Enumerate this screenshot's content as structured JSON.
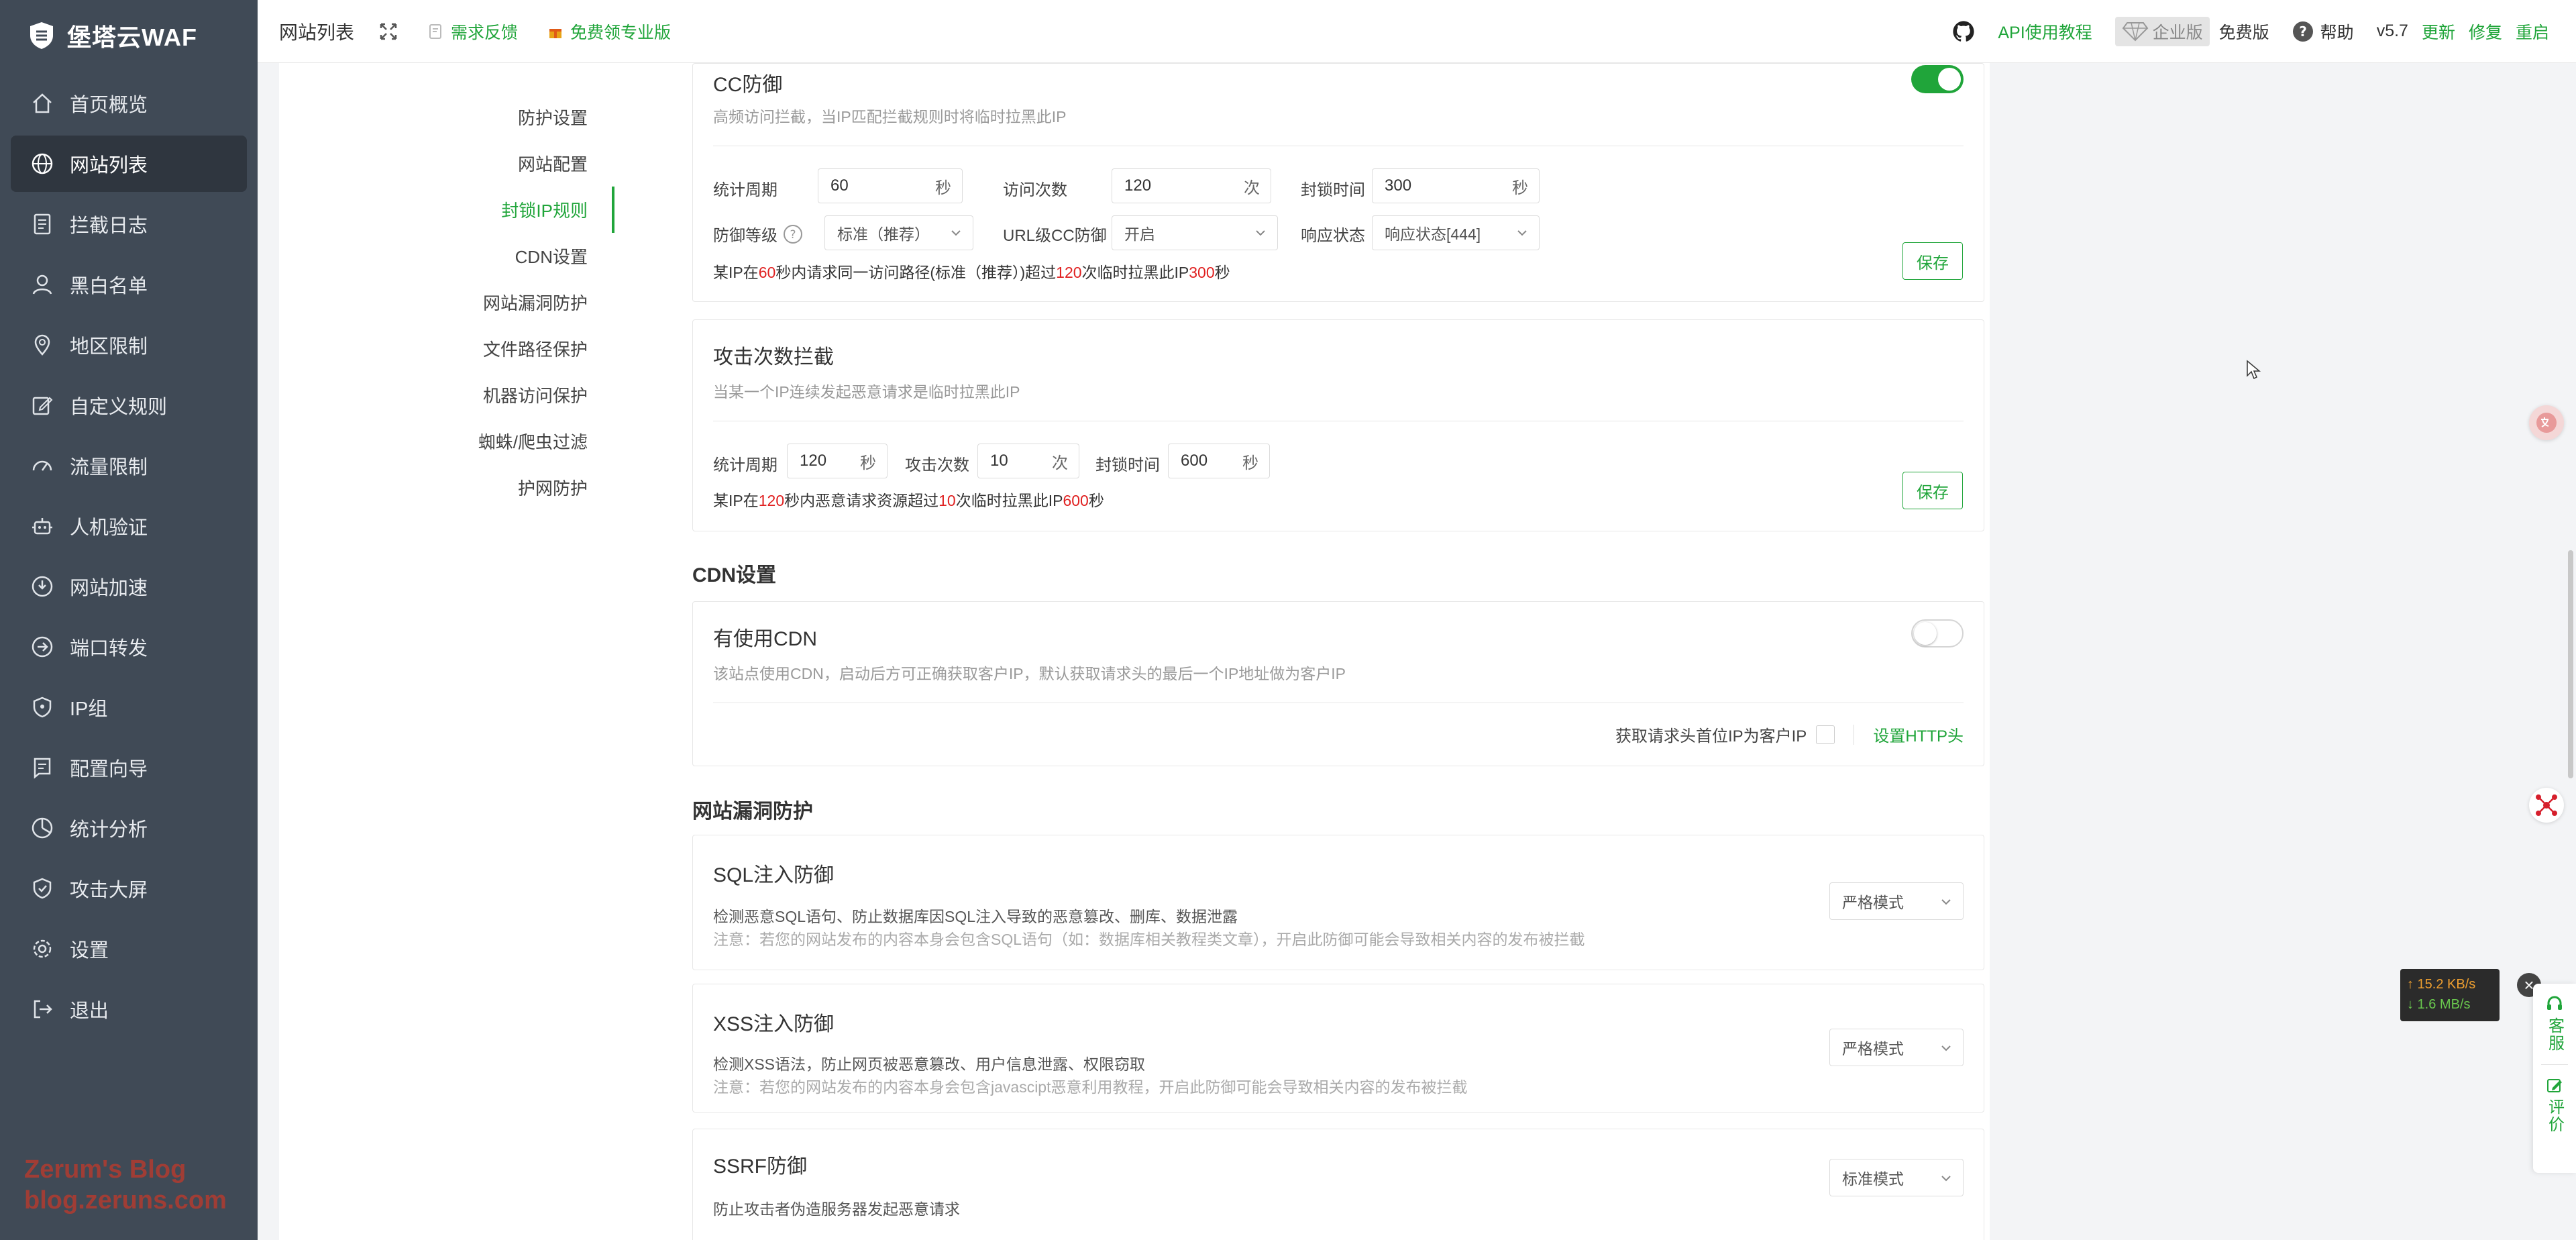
{
  "app": {
    "logo_text": "堡塔云WAF"
  },
  "sidebar": {
    "items": [
      {
        "label": "首页概览",
        "icon": "home-icon"
      },
      {
        "label": "网站列表",
        "icon": "globe-icon",
        "active": true
      },
      {
        "label": "拦截日志",
        "icon": "log-icon"
      },
      {
        "label": "黑白名单",
        "icon": "user-icon"
      },
      {
        "label": "地区限制",
        "icon": "location-icon"
      },
      {
        "label": "自定义规则",
        "icon": "edit-icon"
      },
      {
        "label": "流量限制",
        "icon": "gauge-icon"
      },
      {
        "label": "人机验证",
        "icon": "robot-icon"
      },
      {
        "label": "网站加速",
        "icon": "rocket-icon"
      },
      {
        "label": "端口转发",
        "icon": "forward-icon"
      },
      {
        "label": "IP组",
        "icon": "shield-icon"
      },
      {
        "label": "配置向导",
        "icon": "guide-icon"
      },
      {
        "label": "统计分析",
        "icon": "chart-icon"
      },
      {
        "label": "攻击大屏",
        "icon": "screen-icon"
      },
      {
        "label": "设置",
        "icon": "gear-icon"
      },
      {
        "label": "退出",
        "icon": "logout-icon"
      }
    ],
    "watermark_line1": "Zerum's Blog",
    "watermark_line2": "blog.zeruns.com"
  },
  "header": {
    "title": "网站列表",
    "feedback": "需求反馈",
    "pro": "免费领专业版",
    "api_tutorial": "API使用教程",
    "enterprise": "企业版",
    "free": "免费版",
    "help": "帮助",
    "version": "v5.7",
    "update": "更新",
    "repair": "修复",
    "restart": "重启"
  },
  "subnav": {
    "items": [
      "防护设置",
      "网站配置",
      "封锁IP规则",
      "CDN设置",
      "网站漏洞防护",
      "文件路径保护",
      "机器访问保护",
      "蜘蛛/爬虫过滤",
      "护网防护"
    ],
    "active_index": 2
  },
  "cc": {
    "title": "CC防御",
    "desc": "高频访问拦截，当IP匹配拦截规则时将临时拉黑此IP",
    "enabled": true,
    "period_label": "统计周期",
    "period_value": "60",
    "period_unit": "秒",
    "visits_label": "访问次数",
    "visits_value": "120",
    "visits_unit": "次",
    "ban_label": "封锁时间",
    "ban_value": "300",
    "ban_unit": "秒",
    "level_label": "防御等级",
    "level_value": "标准（推荐）",
    "url_label": "URL级CC防御",
    "url_value": "开启",
    "resp_label": "响应状态",
    "resp_value": "响应状态[444]",
    "summary_p1": "某IP在",
    "summary_v1": "60",
    "summary_p2": "秒内请求同一访问路径(标准（推荐）)超过",
    "summary_v2": "120",
    "summary_p3": "次临时拉黑此IP",
    "summary_v3": "300",
    "summary_p4": "秒",
    "save": "保存"
  },
  "attack": {
    "title": "攻击次数拦截",
    "desc": "当某一个IP连续发起恶意请求是临时拉黑此IP",
    "period_label": "统计周期",
    "period_value": "120",
    "period_unit": "秒",
    "count_label": "攻击次数",
    "count_value": "10",
    "count_unit": "次",
    "ban_label": "封锁时间",
    "ban_value": "600",
    "ban_unit": "秒",
    "summary_p1": "某IP在",
    "summary_v1": "120",
    "summary_p2": "秒内恶意请求资源超过",
    "summary_v2": "10",
    "summary_p3": "次临时拉黑此IP",
    "summary_v3": "600",
    "summary_p4": "秒",
    "save": "保存"
  },
  "cdn": {
    "section": "CDN设置",
    "title": "有使用CDN",
    "desc": "该站点使用CDN，启动后方可正确获取客户IP，默认获取请求头的最后一个IP地址做为客户IP",
    "enabled": false,
    "first_ip_label": "获取请求头首位IP为客户IP",
    "http_header_link": "设置HTTP头"
  },
  "vuln": {
    "section": "网站漏洞防护",
    "sql": {
      "title": "SQL注入防御",
      "desc": "检测恶意SQL语句、防止数据库因SQL注入导致的恶意篡改、删库、数据泄露",
      "note": "注意：若您的网站发布的内容本身会包含SQL语句（如：数据库相关教程类文章），开启此防御可能会导致相关内容的发布被拦截",
      "mode": "严格模式"
    },
    "xss": {
      "title": "XSS注入防御",
      "desc": "检测XSS语法，防止网页被恶意篡改、用户信息泄露、权限窃取",
      "note": "注意：若您的网站发布的内容本身会包含javascipt恶意利用教程，开启此防御可能会导致相关内容的发布被拦截",
      "mode": "严格模式"
    },
    "ssrf": {
      "title": "SSRF防御",
      "desc": "防止攻击者伪造服务器发起恶意请求",
      "mode": "标准模式"
    }
  },
  "widgets": {
    "net_up": "↑ 15.2 KB/s",
    "net_down": "↓ 1.6 MB/s",
    "service": "客服",
    "review": "评价"
  },
  "colors": {
    "accent": "#20a53a",
    "sidebar": "#404a56",
    "danger": "#e02020"
  }
}
